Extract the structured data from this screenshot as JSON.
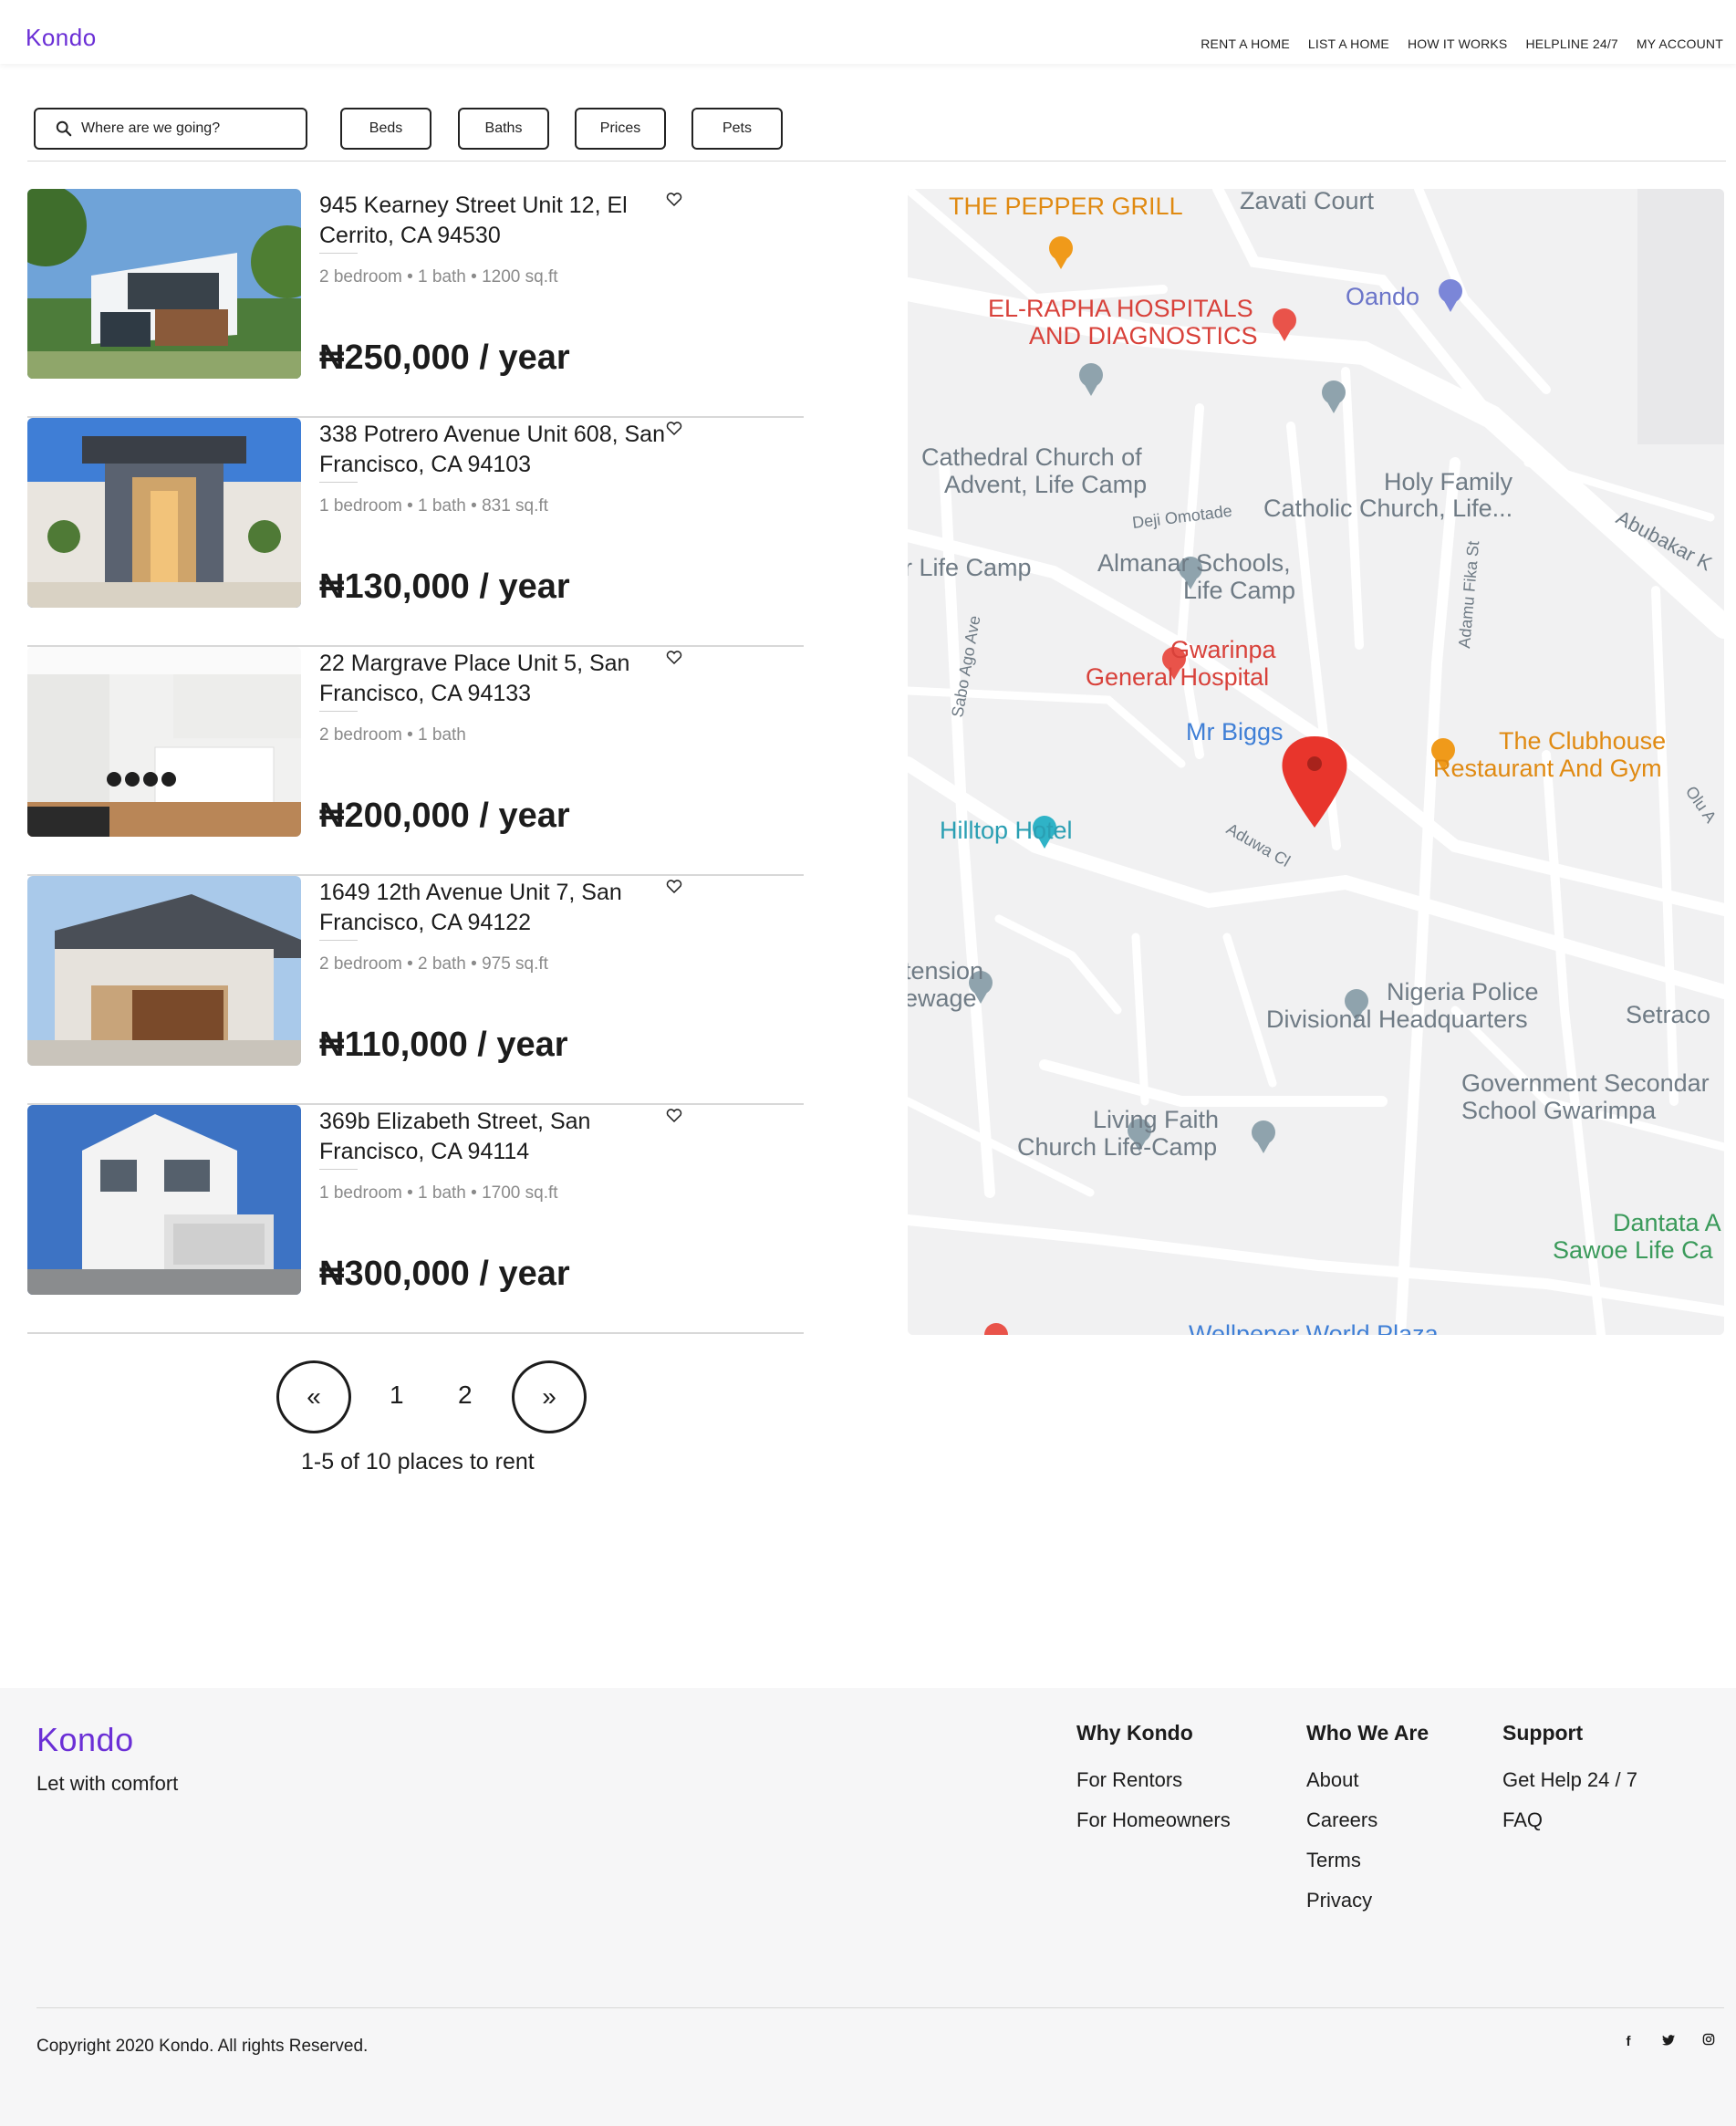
{
  "header": {
    "logo": "Kondo",
    "nav": [
      "RENT A HOME",
      "LIST A HOME",
      "HOW IT WORKS",
      "HELPLINE 24/7",
      "MY ACCOUNT"
    ]
  },
  "filters": {
    "search_placeholder": "Where are we going?",
    "buttons": [
      "Beds",
      "Baths",
      "Prices",
      "Pets"
    ]
  },
  "listings": [
    {
      "address": "945 Kearney Street Unit 12, El Cerrito, CA 94530",
      "specs": "2 bedroom • 1 bath • 1200 sq.ft",
      "price": "₦250,000 / year"
    },
    {
      "address": "338 Potrero Avenue Unit 608, San Francisco, CA 94103",
      "specs": "1 bedroom • 1 bath • 831 sq.ft",
      "price": "₦130,000 / year"
    },
    {
      "address": "22 Margrave Place Unit 5, San Francisco, CA 94133",
      "specs": "2 bedroom • 1 bath",
      "price": "₦200,000 / year"
    },
    {
      "address": "1649 12th Avenue Unit 7, San Francisco, CA 94122",
      "specs": "2 bedroom • 2 bath • 975 sq.ft",
      "price": "₦110,000 / year"
    },
    {
      "address": "369b Elizabeth Street, San Francisco, CA 94114",
      "specs": "1 bedroom • 1 bath • 1700 sq.ft",
      "price": "₦300,000 / year"
    }
  ],
  "pagination": {
    "prev": "«",
    "pages": [
      "1",
      "2"
    ],
    "next": "»",
    "summary": "1-5 of 10 places to rent"
  },
  "map": {
    "labels": [
      "THE PEPPER GRILL",
      "Zavati Court",
      "Oando",
      "EL-RAPHA HOSPITALS",
      "AND DIAGNOSTICS",
      "Cathedral Church of",
      "Advent, Life Camp",
      "Holy Family",
      "Catholic Church, Life...",
      "Deji Omotade",
      "Abubakar K",
      "r Life Camp",
      "Almanar Schools,",
      "Life Camp",
      "Gwarinpa",
      "General Hospital",
      "Mr Biggs",
      "The Clubhouse",
      "Restaurant And Gym",
      "Sabo Ago Ave",
      "Adamu Fika St",
      "Hilltop Hotel",
      "Aduwa Cl",
      "Olu A",
      "tension",
      "ewage",
      "Nigeria Police",
      "Divisional Headquarters",
      "Setraco",
      "Government Secondar",
      "School Gwarimpa",
      "Living Faith",
      "Church Life-Camp",
      "Dantata A",
      "Sawoe Life Ca",
      "Wellpeper World Plaza"
    ]
  },
  "footer": {
    "logo": "Kondo",
    "tagline": "Let with comfort",
    "columns": [
      {
        "title": "Why Kondo",
        "links": [
          "For Rentors",
          "For Homeowners"
        ]
      },
      {
        "title": "Who We Are",
        "links": [
          "About",
          "Careers",
          "Terms",
          "Privacy"
        ]
      },
      {
        "title": "Support",
        "links": [
          "Get Help 24 / 7",
          "FAQ"
        ]
      }
    ],
    "copyright": "Copyright 2020 Kondo. All rights Reserved.",
    "social": [
      "f",
      "t",
      "o"
    ]
  },
  "colors": {
    "brand": "#6b2fd6",
    "text": "#1c1c1c",
    "muted": "#8a8a8a"
  }
}
